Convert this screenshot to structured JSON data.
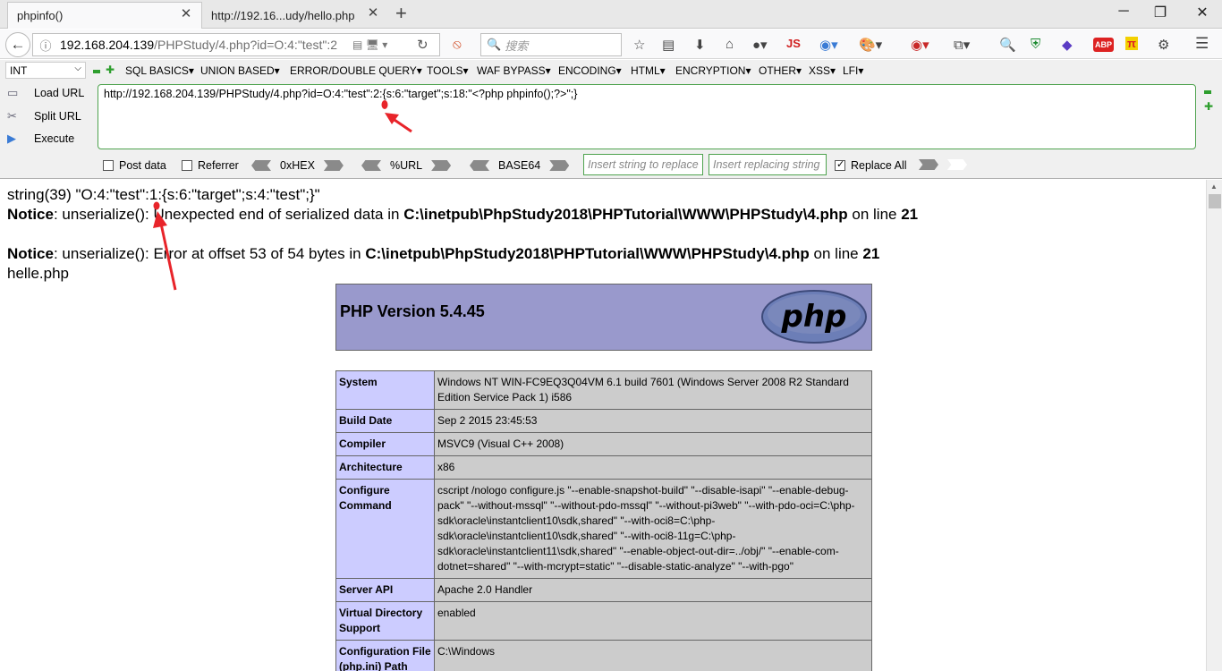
{
  "tabs": [
    {
      "title": "phpinfo()",
      "active": true
    },
    {
      "title": "http://192.16...udy/hello.php",
      "active": false
    }
  ],
  "window_controls": [
    "minimize",
    "maximize",
    "close"
  ],
  "nav": {
    "url_host": "192.168.204.139",
    "url_path": "/PHPStudy/4.php?id=O:4:\"test\":2",
    "search_placeholder": "搜索",
    "js_label": "JS",
    "abp_label": "ABP"
  },
  "hackbar": {
    "select_value": "INT",
    "menu": [
      "SQL BASICS▾",
      "UNION BASED▾",
      "ERROR/DOUBLE QUERY▾",
      "TOOLS▾",
      "WAF BYPASS▾",
      "ENCODING▾",
      "HTML▾",
      "ENCRYPTION▾",
      "OTHER▾",
      "XSS▾",
      "LFI▾"
    ],
    "load_url": "Load URL",
    "split_url": "Split URL",
    "execute": "Execute",
    "url_text": "http://192.168.204.139/PHPStudy/4.php?id=O:4:\"test\":2:{s:6:\"target\";s:18:\"<?php phpinfo();?>\";}",
    "post_data": "Post data",
    "referrer": "Referrer",
    "hex": "0xHEX",
    "url_enc": "%URL",
    "base64": "BASE64",
    "insert_string_placeholder": "Insert string to replace",
    "insert_replacing_placeholder": "Insert replacing string",
    "replace_all": "Replace All"
  },
  "output": {
    "dump": "string(39) \"O:4:\"test\":1:{s:6:\"target\";s:4:\"test\";}\"",
    "notice1_label": "Notice",
    "notice1_text": ": unserialize(): Unexpected end of serialized data in ",
    "notice1_path": "C:\\inetpub\\PhpStudy2018\\PHPTutorial\\WWW\\PHPStudy\\4.php",
    "notice1_online": " on line ",
    "notice1_line": "21",
    "notice2_label": "Notice",
    "notice2_text": ": unserialize(): Error at offset 53 of 54 bytes in ",
    "notice2_path": "C:\\inetpub\\PhpStudy2018\\PHPTutorial\\WWW\\PHPStudy\\4.php",
    "notice2_online": " on line ",
    "notice2_line": "21",
    "extra": "helle.php"
  },
  "phpinfo": {
    "version": "PHP Version 5.4.45",
    "logo_text": "php",
    "rows": [
      {
        "key": "System",
        "value": "Windows NT WIN-FC9EQ3Q04VM 6.1 build 7601 (Windows Server 2008 R2 Standard Edition Service Pack 1) i586"
      },
      {
        "key": "Build Date",
        "value": "Sep 2 2015 23:45:53"
      },
      {
        "key": "Compiler",
        "value": "MSVC9 (Visual C++ 2008)"
      },
      {
        "key": "Architecture",
        "value": "x86"
      },
      {
        "key": "Configure Command",
        "value": "cscript /nologo configure.js \"--enable-snapshot-build\" \"--disable-isapi\" \"--enable-debug-pack\" \"--without-mssql\" \"--without-pdo-mssql\" \"--without-pi3web\" \"--with-pdo-oci=C:\\php-sdk\\oracle\\instantclient10\\sdk,shared\" \"--with-oci8=C:\\php-sdk\\oracle\\instantclient10\\sdk,shared\" \"--with-oci8-11g=C:\\php-sdk\\oracle\\instantclient11\\sdk,shared\" \"--enable-object-out-dir=../obj/\" \"--enable-com-dotnet=shared\" \"--with-mcrypt=static\" \"--disable-static-analyze\" \"--with-pgo\""
      },
      {
        "key": "Server API",
        "value": "Apache 2.0 Handler"
      },
      {
        "key": "Virtual Directory Support",
        "value": "enabled"
      },
      {
        "key": "Configuration File (php.ini) Path",
        "value": "C:\\Windows"
      }
    ]
  },
  "colors": {
    "annotation": "#e8242a",
    "php_header": "#9999cc",
    "php_key": "#ccccff",
    "php_value": "#cccccc",
    "hackbar_green": "#4fa34f"
  }
}
